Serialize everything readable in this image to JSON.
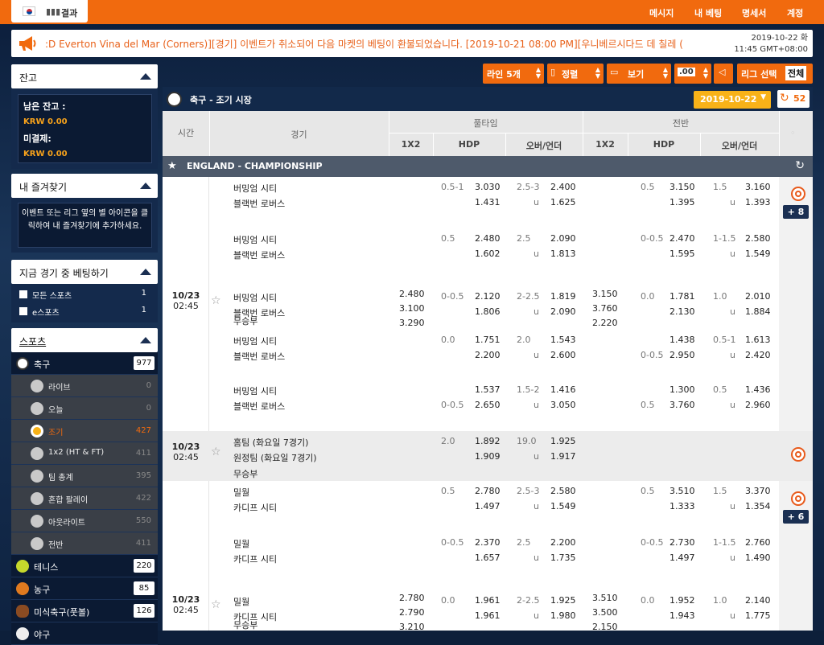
{
  "topbar": {
    "results_label": "결과",
    "nav": [
      "메시지",
      "내 베팅",
      "명세서",
      "계정"
    ]
  },
  "ticker": {
    "text": ":D Everton Vina del Mar (Corners)][경기]      이벤트가 취소되어 다음 마켓의 베팅이 환불되었습니다. [2019-10-21 08:00 PM][우니베르시다드 데 칠레 (",
    "date": "2019-10-22 화",
    "time": "11:45 GMT+08:00"
  },
  "sidebar": {
    "balance": {
      "title": "잔고",
      "remaining_label": "남은 잔고 :",
      "remaining_value": "KRW 0.00",
      "pending_label": "미결제:",
      "pending_value": "KRW 0.00"
    },
    "favorites": {
      "title": "내 즐겨찾기",
      "hint": "이벤트 또는 리그 옆의 별 아이콘을 클릭하여 내 즐겨찾기에 추가하세요."
    },
    "live": {
      "title": "지금 경기 중 베팅하기",
      "items": [
        {
          "label": "모든 스포츠",
          "count": "1"
        },
        {
          "label": "e스포츠",
          "count": "1"
        }
      ]
    },
    "sports": {
      "title": "스포츠",
      "soccer": {
        "label": "축구",
        "count": "977"
      },
      "sub": [
        {
          "label": "라이브",
          "count": "0"
        },
        {
          "label": "오늘",
          "count": "0"
        },
        {
          "label": "조기",
          "count": "427"
        },
        {
          "label": "1x2 (HT & FT)",
          "count": "411"
        },
        {
          "label": "팀 총계",
          "count": "395"
        },
        {
          "label": "혼합 팔레이",
          "count": "422"
        },
        {
          "label": "아웃라이트",
          "count": "550"
        },
        {
          "label": "전반",
          "count": "411"
        }
      ],
      "others": [
        {
          "label": "테니스",
          "count": "220"
        },
        {
          "label": "농구",
          "count": "85"
        },
        {
          "label": "미식축구(풋볼)",
          "count": "126"
        },
        {
          "label": "야구",
          "count": ""
        }
      ]
    }
  },
  "toolbar": {
    "lines": "라인 5개",
    "sort": "정렬",
    "view": "보기",
    "odds": ".00",
    "league_select": "리그 선택",
    "league_all": "전체"
  },
  "main": {
    "title": "축구 - 조기 시장",
    "date": "2019-10-22",
    "count": "52",
    "headers": {
      "time": "시간",
      "match": "경기",
      "full_time": "풀타임",
      "first_half": "전반",
      "c1x2": "1X2",
      "hdp": "HDP",
      "ou": "오버/언더"
    },
    "league": "ENGLAND - CHAMPIONSHIP",
    "rows": [
      {
        "home": "버밍엄 시티",
        "away": "블랙번 로버스",
        "hdpl": "0.5-1",
        "hdp1": "3.030",
        "hdp2": "1.431",
        "oul": "2.5-3",
        "ou1": "2.400",
        "ouu": "u",
        "ou2": "1.625",
        "hhdpl": "0.5",
        "hhdp1": "3.150",
        "hhdp2": "1.395",
        "houl": "1.5",
        "hou1": "3.160",
        "houu": "u",
        "hou2": "1.393"
      },
      {
        "home": "버밍엄 시티",
        "away": "블랙번 로버스",
        "hdpl": "0.5",
        "hdp1": "2.480",
        "hdp2": "1.602",
        "oul": "2.5",
        "ou1": "2.090",
        "ouu": "u",
        "ou2": "1.813",
        "hhdpl": "0-0.5",
        "hhdp1": "2.470",
        "hhdp2": "1.595",
        "houl": "1-1.5",
        "hou1": "2.580",
        "houu": "u",
        "hou2": "1.549"
      },
      {
        "date": "10/23",
        "time": "02:45",
        "home": "버밍엄 시티",
        "away": "블랙번 로버스",
        "draw": "무승부",
        "x1": "2.480",
        "x2": "3.100",
        "x3": "3.290",
        "hdpl": "0-0.5",
        "hdp1": "2.120",
        "hdp2": "1.806",
        "oul": "2-2.5",
        "ou1": "1.819",
        "ouu": "u",
        "ou2": "2.090",
        "hx1": "3.150",
        "hx2": "3.760",
        "hx3": "2.220",
        "hhdpl": "0.0",
        "hhdp1": "1.781",
        "hhdp2": "2.130",
        "houl": "1.0",
        "hou1": "2.010",
        "houu": "u",
        "hou2": "1.884"
      },
      {
        "home": "버밍엄 시티",
        "away": "블랙번 로버스",
        "hdpl": "0.0",
        "hdp1": "1.751",
        "hdp2": "2.200",
        "oul": "2.0",
        "ou1": "1.543",
        "ouu": "u",
        "ou2": "2.600",
        "hhdpl2": "0-0.5",
        "hhdp1": "1.438",
        "hhdp2": "2.950",
        "houl": "0.5-1",
        "hou1": "1.613",
        "houu": "u",
        "hou2": "2.420"
      },
      {
        "home": "버밍엄 시티",
        "away": "블랙번 로버스",
        "hdpl2": "0-0.5",
        "hdp1": "1.537",
        "hdp2": "2.650",
        "oul": "1.5-2",
        "ou1": "1.416",
        "ouu": "u",
        "ou2": "3.050",
        "hhdpl2": "0.5",
        "hhdp1": "1.300",
        "hhdp2": "3.760",
        "houl": "0.5",
        "hou1": "1.436",
        "houu": "u",
        "hou2": "2.960"
      },
      {
        "date": "10/23",
        "time": "02:45",
        "home": "홈팀 (화요일 7경기)",
        "away": "원정팀 (화요일 7경기)",
        "draw": "무승부",
        "hdpl": "2.0",
        "hdp1": "1.892",
        "hdp2": "1.909",
        "oul": "19.0",
        "ou1": "1.925",
        "ouu": "u",
        "ou2": "1.917"
      },
      {
        "home": "밀월",
        "away": "카디프 시티",
        "hdpl": "0.5",
        "hdp1": "2.780",
        "hdp2": "1.497",
        "oul": "2.5-3",
        "ou1": "2.580",
        "ouu": "u",
        "ou2": "1.549",
        "hhdpl": "0.5",
        "hhdp1": "3.510",
        "hhdp2": "1.333",
        "houl": "1.5",
        "hou1": "3.370",
        "houu": "u",
        "hou2": "1.354"
      },
      {
        "home": "밀월",
        "away": "카디프 시티",
        "hdpl": "0-0.5",
        "hdp1": "2.370",
        "hdp2": "1.657",
        "oul": "2.5",
        "ou1": "2.200",
        "ouu": "u",
        "ou2": "1.735",
        "hhdpl": "0-0.5",
        "hhdp1": "2.730",
        "hhdp2": "1.497",
        "houl": "1-1.5",
        "hou1": "2.760",
        "houu": "u",
        "hou2": "1.490"
      },
      {
        "date": "10/23",
        "time": "02:45",
        "home": "밀월",
        "away": "카디프 시티",
        "draw": "무승부",
        "x1": "2.780",
        "x2": "2.790",
        "x3": "3.210",
        "hdpl": "0.0",
        "hdp1": "1.961",
        "hdp2": "1.961",
        "oul": "2-2.5",
        "ou1": "1.925",
        "ouu": "u",
        "ou2": "1.980",
        "hx1": "3.510",
        "hx2": "3.500",
        "hx3": "2.150",
        "hhdpl": "0.0",
        "hhdp1": "1.952",
        "hhdp2": "1.943",
        "houl": "1.0",
        "hou1": "2.140",
        "houu": "u",
        "hou2": "1.775"
      }
    ],
    "plus1": "+ 8",
    "plus2": "+ 6"
  },
  "colors": {
    "accent": "#f16a0e",
    "navy": "#12294a",
    "date_yellow": "#f8b218"
  }
}
